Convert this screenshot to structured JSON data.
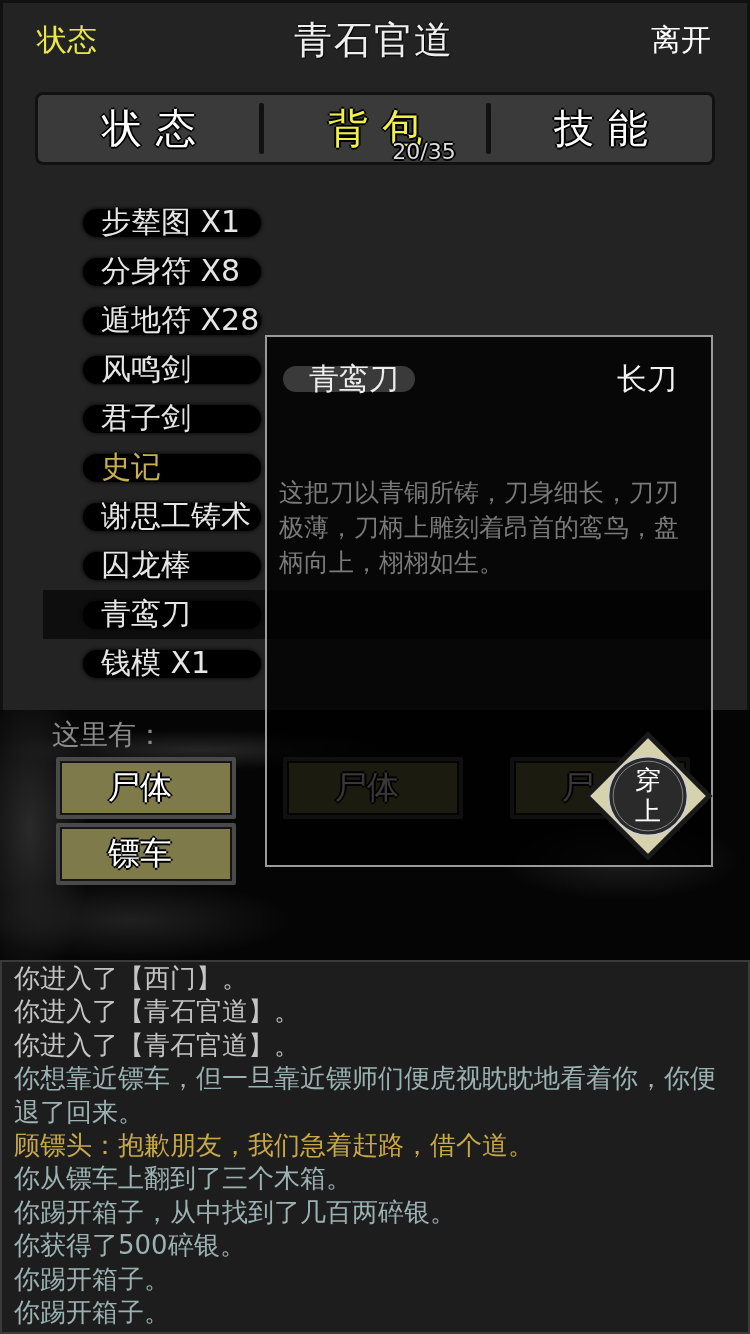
{
  "header": {
    "status_button": "状态",
    "title": "青石官道",
    "leave_button": "离开"
  },
  "tabs": [
    {
      "label": "状态",
      "selected": false
    },
    {
      "label": "背包",
      "selected": true,
      "count": "20/35"
    },
    {
      "label": "技能",
      "selected": false
    }
  ],
  "items": [
    {
      "label": "步辇图 X1",
      "selected": false,
      "color": "#e6e6e6"
    },
    {
      "label": "分身符 X8",
      "selected": false,
      "color": "#e6e6e6"
    },
    {
      "label": "遁地符 X28",
      "selected": false,
      "color": "#e6e6e6"
    },
    {
      "label": "风鸣剑",
      "selected": false,
      "color": "#e6e6e6"
    },
    {
      "label": "君子剑",
      "selected": false,
      "color": "#e6e6e6"
    },
    {
      "label": "史记",
      "selected": false,
      "color": "#c9b04a"
    },
    {
      "label": "谢思工铸术",
      "selected": false,
      "color": "#e6e6e6"
    },
    {
      "label": "囚龙棒",
      "selected": false,
      "color": "#e6e6e6"
    },
    {
      "label": "青鸾刀",
      "selected": true,
      "color": "#e6e6e6"
    },
    {
      "label": "钱模 X1",
      "selected": false,
      "color": "#e6e6e6"
    }
  ],
  "scene": {
    "label": "这里有：",
    "objects": [
      {
        "label": "尸体"
      },
      {
        "label": "尸体"
      },
      {
        "label": "尸"
      },
      {
        "label": "镖车"
      }
    ]
  },
  "popup": {
    "name": "青鸾刀",
    "type": "长刀",
    "description": "这把刀以青铜所铸，刀身细长，刀刃极薄，刀柄上雕刻着昂首的鸾鸟，盘柄向上，栩栩如生。",
    "action": "穿上"
  },
  "log": [
    {
      "text": "你进入了【西门】。",
      "color": "#c4c4c4"
    },
    {
      "text": "你进入了【青石官道】。",
      "color": "#c4c4c4"
    },
    {
      "text": "你进入了【青石官道】。",
      "color": "#c4c4c4"
    },
    {
      "text": "你想靠近镖车，但一旦靠近镖师们便虎视眈眈地看着你，你便退了回来。",
      "color": "#9cb2b2"
    },
    {
      "text": "顾镖头：抱歉朋友，我们急着赶路，借个道。",
      "color": "#c8a848"
    },
    {
      "text": "你从镖车上翻到了三个木箱。",
      "color": "#9cb2b2"
    },
    {
      "text": "你踢开箱子，从中找到了几百两碎银。",
      "color": "#9cb2b2"
    },
    {
      "text": "你获得了500碎银。",
      "color": "#9cb2b2"
    },
    {
      "text": "你踢开箱子。",
      "color": "#9cb2b2"
    },
    {
      "text": "你踢开箱子。",
      "color": "#9cb2b2"
    }
  ]
}
